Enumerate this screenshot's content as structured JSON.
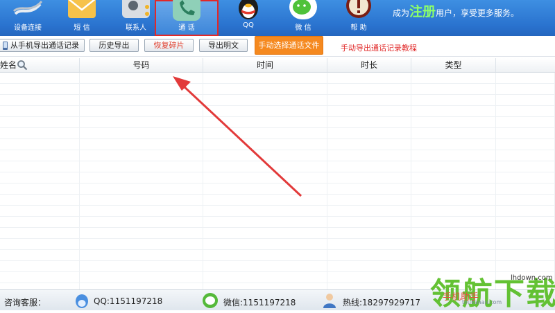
{
  "toolbar": {
    "tools": [
      {
        "label": "设备连接",
        "icon": "device-link-icon"
      },
      {
        "label": "短 信",
        "icon": "sms-envelope-icon"
      },
      {
        "label": "联系人",
        "icon": "contacts-icon"
      },
      {
        "label": "通 话",
        "icon": "phone-call-icon",
        "active": true
      },
      {
        "label": "QQ",
        "icon": "qq-penguin-icon"
      },
      {
        "label": "微 信",
        "icon": "wechat-icon"
      },
      {
        "label": "帮 助",
        "icon": "help-icon"
      }
    ],
    "register_prefix": "成为",
    "register_link": "注册",
    "register_suffix": "用户，享受更多服务。"
  },
  "actions": {
    "export_from_phone": "从手机导出通话记录",
    "history_export": "历史导出",
    "recover_fragments": "恢复碎片",
    "export_plaintext": "导出明文",
    "manual_select_file": "手动选择通话文件",
    "manual_export_tutorial": "手动导出通话记录教程"
  },
  "table": {
    "columns": [
      "姓名",
      "号码",
      "时间",
      "时长",
      "类型"
    ],
    "rows": []
  },
  "status_bar": {
    "consult_label": "咨询客服：",
    "qq": "QQ:1151197218",
    "wechat": "微信:1151197218",
    "hotline": "热线:18297929717"
  },
  "watermark": {
    "brand": "领航下载",
    "url": "lhdown.com",
    "sub_url": "toukanan.com",
    "tag": "手机助手"
  },
  "colors": {
    "toolbar_blue": "#2a73cf",
    "active_border": "#e22828",
    "arrow": "#e23a3a",
    "orange_button": "#f5891f"
  }
}
